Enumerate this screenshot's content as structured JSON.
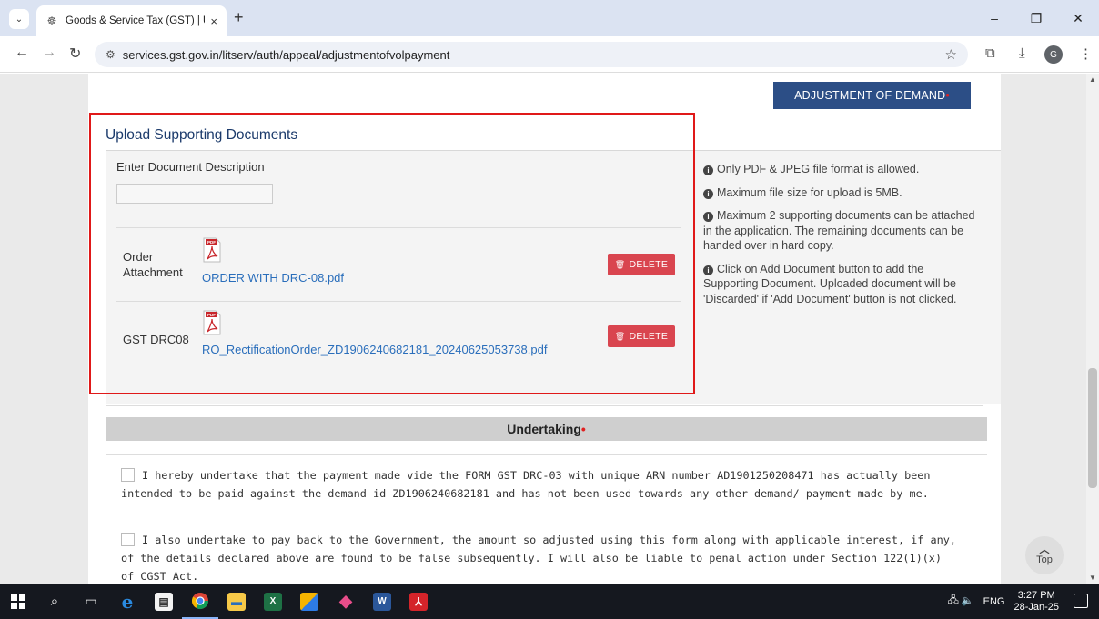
{
  "browser": {
    "tab_title": "Goods & Service Tax (GST) | Use",
    "tab_close": "×",
    "new_tab": "+",
    "tab_menu": "⌄",
    "url": "services.gst.gov.in/litserv/auth/appeal/adjustmentofvolpayment",
    "profile_initial": "G",
    "win_minimize": "–",
    "win_restore": "❐",
    "win_close": "✕"
  },
  "page": {
    "adjustment_button_label": "ADJUSTMENT OF DEMAND",
    "upload_title": "Upload Supporting Documents",
    "doc_description_label": "Enter Document Description",
    "doc_description_value": "",
    "documents": [
      {
        "label_line1": "Order",
        "label_line2": "Attachment",
        "filename": "ORDER WITH DRC-08.pdf",
        "delete_label": "DELETE",
        "icon": "pdf-icon"
      },
      {
        "label_line1": "GST DRC08",
        "label_line2": "",
        "filename": "RO_RectificationOrder_ZD1906240682181_20240625053738.pdf",
        "delete_label": "DELETE",
        "icon": "pdf-icon"
      }
    ],
    "info": [
      "Only PDF & JPEG file format is allowed.",
      "Maximum file size for upload is 5MB.",
      "Maximum 2 supporting documents can be attached in the application. The remaining documents can be handed over in hard copy.",
      "Click on Add Document button to add the Supporting Document. Uploaded document will be 'Discarded' if 'Add Document' button is not clicked."
    ],
    "undertaking_title": "Undertaking",
    "undertakings": [
      "I hereby undertake that the payment made vide the FORM GST DRC-03 with unique ARN number AD1901250208471 has actually been intended to be paid against the demand id ZD1906240682181 and has not been used towards any other demand/ payment made by me.",
      "I also undertake to pay back to the Government, the amount so adjusted using this form along with applicable interest, if any, of the details declared above are found to be false subsequently. I will also be liable to penal action under Section 122(1)(x) of CGST Act."
    ],
    "top_button_label": "Top"
  },
  "taskbar": {
    "language": "ENG",
    "time": "3:27 PM",
    "date": "28-Jan-25"
  },
  "colors": {
    "accent_blue": "#2c4e86",
    "delete_red": "#d9454f",
    "highlight_red": "#e01919",
    "link_blue": "#2a6ebb"
  }
}
